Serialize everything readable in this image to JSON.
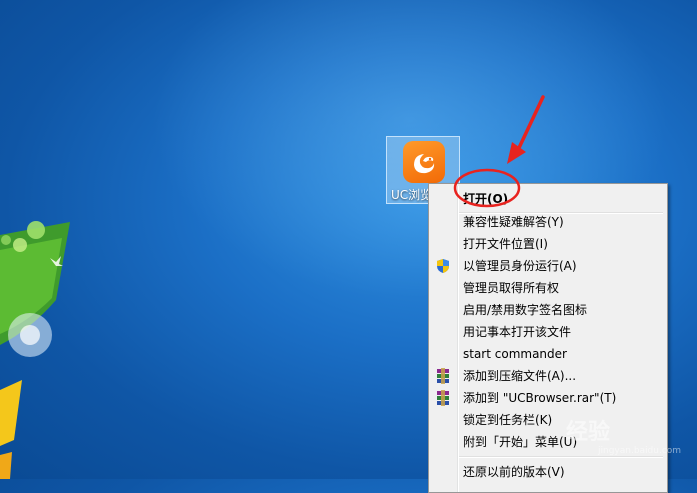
{
  "desktop": {
    "icon_label": "UC浏览器"
  },
  "context_menu": {
    "items": [
      {
        "label": "打开(O)",
        "bold": true
      },
      {
        "label": "兼容性疑难解答(Y)"
      },
      {
        "label": "打开文件位置(I)"
      },
      {
        "label": "以管理员身份运行(A)",
        "icon": "uac-shield-icon"
      },
      {
        "label": "管理员取得所有权"
      },
      {
        "label": "启用/禁用数字签名图标"
      },
      {
        "label": "用记事本打开该文件"
      },
      {
        "label": "start commander"
      },
      {
        "label": "添加到压缩文件(A)...",
        "icon": "winrar-icon"
      },
      {
        "label": "添加到 \"UCBrowser.rar\"(T)",
        "icon": "winrar-icon"
      },
      {
        "label": "锁定到任务栏(K)"
      },
      {
        "label": "附到「开始」菜单(U)"
      },
      {
        "label": "还原以前的版本(V)"
      }
    ]
  },
  "watermark": {
    "text": "经验",
    "sub": "jingyan.baidu.com"
  },
  "colors": {
    "annotation_red": "#e8231f",
    "uc_orange": "#f57c12"
  }
}
